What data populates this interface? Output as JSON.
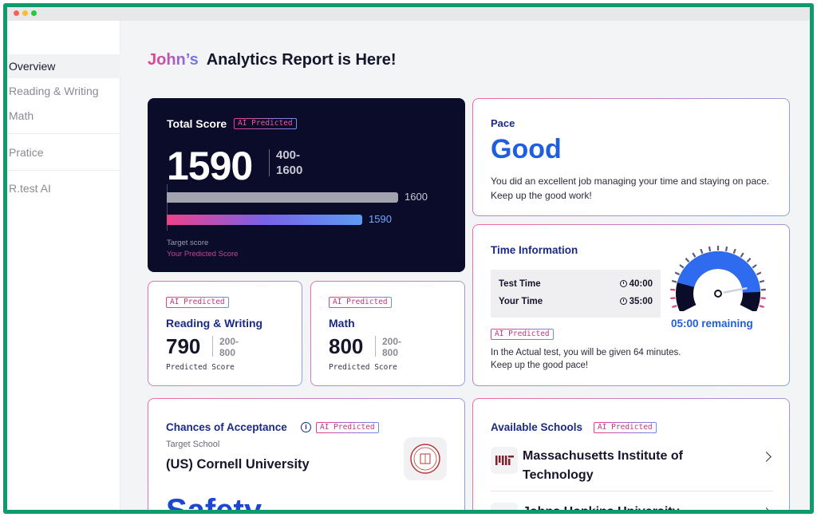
{
  "sidebar": {
    "items": [
      {
        "label": "Overview",
        "active": true
      },
      {
        "label": "Reading & Writing"
      },
      {
        "label": "Math"
      },
      {
        "label": "Pratice"
      },
      {
        "label": "R.test AI"
      }
    ]
  },
  "header": {
    "name": "John’s",
    "title": "Analytics Report is Here!"
  },
  "badge_label": "AI Predicted",
  "total_score": {
    "label": "Total Score",
    "score": "1590",
    "range_line1": "400-",
    "range_line2": "1600",
    "target_value": "1600",
    "predicted_value": "1590",
    "target_fraction": 1.0,
    "predicted_fraction": 0.845,
    "legend_target": "Target score",
    "legend_predicted": "Your Predicted Score"
  },
  "reading": {
    "title": "Reading & Writing",
    "score": "790",
    "range_line1": "200-",
    "range_line2": "800",
    "caption": "Predicted Score"
  },
  "math": {
    "title": "Math",
    "score": "800",
    "range_line1": "200-",
    "range_line2": "800",
    "caption": "Predicted Score"
  },
  "pace": {
    "heading": "Pace",
    "value": "Good",
    "description": "You did an excellent job managing your time and staying on pace. Keep up the good work!"
  },
  "time_info": {
    "heading": "Time Information",
    "rows": [
      {
        "label": "Test Time",
        "value": "40:00"
      },
      {
        "label": "Your Time",
        "value": "35:00"
      }
    ],
    "remaining": "05:00 remaining",
    "gauge_fraction": 0.875,
    "description_line1": "In the Actual test, you will be given 64 minutes.",
    "description_line2": "Keep up the good pace!"
  },
  "chances": {
    "heading": "Chances of Acceptance",
    "target_label": "Target School",
    "school": "(US) Cornell University",
    "result": "Safety"
  },
  "schools": {
    "heading": "Available Schools",
    "items": [
      {
        "name": "Massachusetts Institute of Technology",
        "logo_text": "MIT"
      },
      {
        "name": "Johns Hopkins University",
        "logo_text": "JHU"
      }
    ]
  },
  "colors": {
    "accent_blue": "#1f5ee0",
    "navy": "#1a2a86",
    "dark_card": "#0b0b2a",
    "pink": "#ec3d8a",
    "frame_green": "#0f9a6e"
  }
}
